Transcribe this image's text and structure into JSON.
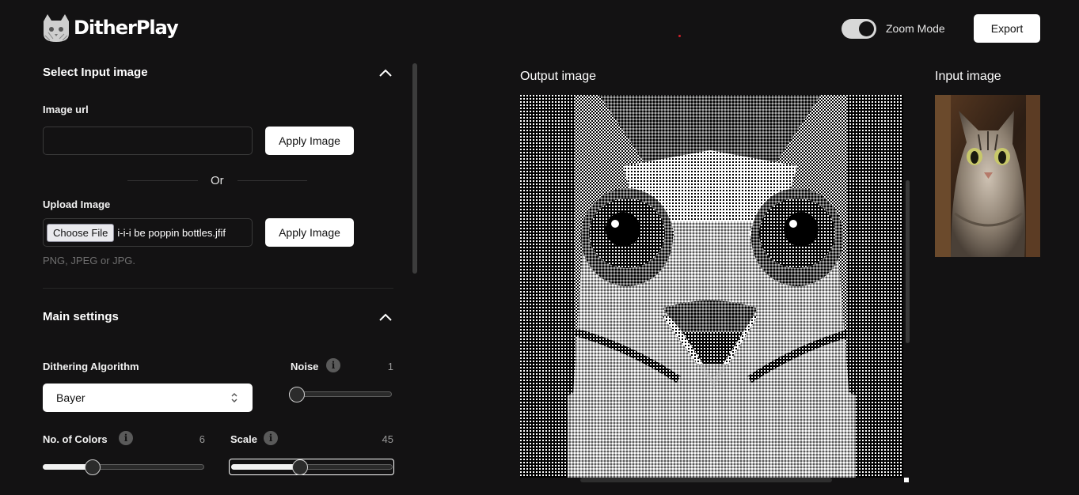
{
  "app": {
    "logo_text": "DitherPlay"
  },
  "header": {
    "zoom_label": "Zoom Mode",
    "zoom_on": true,
    "export_label": "Export"
  },
  "input_section": {
    "title": "Select Input image",
    "url_label": "Image url",
    "url_value": "",
    "url_placeholder": "",
    "apply_url_label": "Apply Image",
    "or_text": "Or",
    "upload_label": "Upload Image",
    "choose_file_label": "Choose File",
    "file_name": "i-i-i be poppin bottles.jfif",
    "apply_upload_label": "Apply Image",
    "formats_hint": "PNG, JPEG or JPG."
  },
  "main_settings": {
    "title": "Main settings",
    "algorithm": {
      "label": "Dithering Algorithm",
      "selected": "Bayer"
    },
    "noise": {
      "label": "Noise",
      "value": "1",
      "level": 0.0
    },
    "colors": {
      "label": "No. of Colors",
      "value": "6",
      "level": 0.29
    },
    "scale": {
      "label": "Scale",
      "value": "45",
      "level": 0.42
    }
  },
  "output": {
    "title": "Output image"
  },
  "input_preview": {
    "title": "Input image"
  },
  "colors": {
    "background": "#131213",
    "accent": "#ffffff",
    "muted": "#6f6f6f"
  }
}
